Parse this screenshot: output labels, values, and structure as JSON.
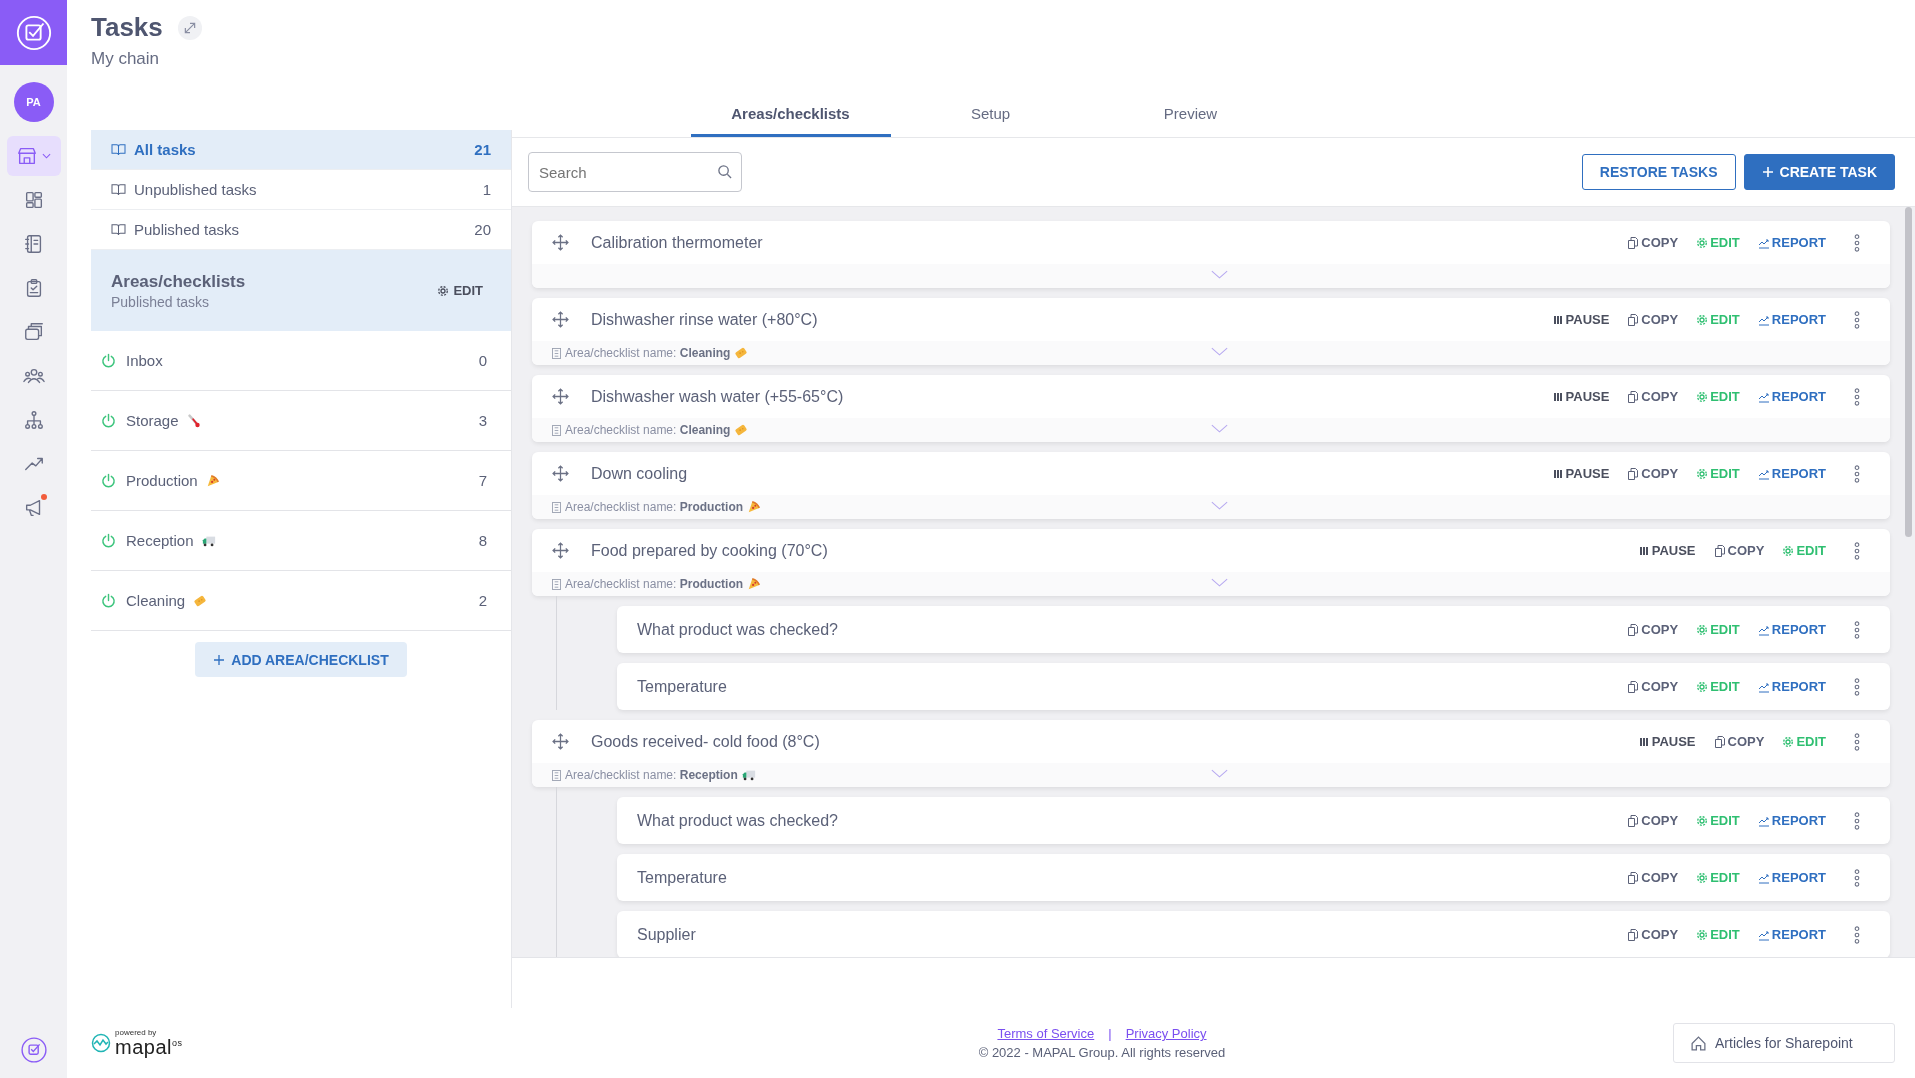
{
  "rail": {
    "avatar": "PA",
    "nav": [
      {
        "kind": "store",
        "selected": true,
        "notification": false
      },
      {
        "kind": "dashboard",
        "selected": false,
        "notification": false
      },
      {
        "kind": "notebook",
        "selected": false,
        "notification": false
      },
      {
        "kind": "clipboard",
        "selected": false,
        "notification": false
      },
      {
        "kind": "cards",
        "selected": false,
        "notification": false
      },
      {
        "kind": "people",
        "selected": false,
        "notification": false
      },
      {
        "kind": "hierarchy",
        "selected": false,
        "notification": false
      },
      {
        "kind": "trend",
        "selected": false,
        "notification": false
      },
      {
        "kind": "megaphone",
        "selected": false,
        "notification": true
      }
    ]
  },
  "header": {
    "title": "Tasks",
    "subtitle": "My chain"
  },
  "filters": [
    {
      "label": "All tasks",
      "count": "21",
      "selected": true
    },
    {
      "label": "Unpublished tasks",
      "count": "1",
      "selected": false
    },
    {
      "label": "Published tasks",
      "count": "20",
      "selected": false
    }
  ],
  "areas_header": {
    "title": "Areas/checklists",
    "subtitle": "Published tasks",
    "edit": "EDIT"
  },
  "areas": [
    {
      "label": "Inbox",
      "kind": "plain",
      "count": "0"
    },
    {
      "label": "Storage",
      "kind": "thermometer",
      "count": "3"
    },
    {
      "label": "Production",
      "kind": "pizza",
      "count": "7"
    },
    {
      "label": "Reception",
      "kind": "truck",
      "count": "8"
    },
    {
      "label": "Cleaning",
      "kind": "sponge",
      "count": "2"
    }
  ],
  "add_area": "ADD AREA/CHECKLIST",
  "tabs": [
    {
      "label": "Areas/checklists",
      "selected": true
    },
    {
      "label": "Setup",
      "selected": false
    },
    {
      "label": "Preview",
      "selected": false
    }
  ],
  "search": {
    "placeholder": "Search"
  },
  "buttons": [
    {
      "kind": "outline",
      "label": "RESTORE TASKS"
    },
    {
      "kind": "primary",
      "label": "CREATE TASK"
    }
  ],
  "tasks": [
    {
      "title": "Calibration thermometer",
      "actions": [
        {
          "kind": "copy",
          "label": "COPY"
        },
        {
          "kind": "edit",
          "label": "EDIT"
        },
        {
          "kind": "report",
          "label": "REPORT"
        }
      ]
    },
    {
      "title": "Dishwasher rinse water (+80°C)",
      "area": {
        "text": "Area/checklist name: **Cleaning**",
        "kind": "sponge"
      },
      "actions": [
        {
          "kind": "pause",
          "label": "PAUSE"
        },
        {
          "kind": "copy",
          "label": "COPY"
        },
        {
          "kind": "edit",
          "label": "EDIT"
        },
        {
          "kind": "report",
          "label": "REPORT"
        }
      ]
    },
    {
      "title": "Dishwasher wash water (+55-65°C)",
      "area": {
        "text": "Area/checklist name: **Cleaning**",
        "kind": "sponge"
      },
      "actions": [
        {
          "kind": "pause",
          "label": "PAUSE"
        },
        {
          "kind": "copy",
          "label": "COPY"
        },
        {
          "kind": "edit",
          "label": "EDIT"
        },
        {
          "kind": "report",
          "label": "REPORT"
        }
      ]
    },
    {
      "title": "Down cooling",
      "area": {
        "text": "Area/checklist name: **Production**",
        "kind": "pizza"
      },
      "actions": [
        {
          "kind": "pause",
          "label": "PAUSE"
        },
        {
          "kind": "copy",
          "label": "COPY"
        },
        {
          "kind": "edit",
          "label": "EDIT"
        },
        {
          "kind": "report",
          "label": "REPORT"
        }
      ]
    },
    {
      "title": "Food prepared by cooking (70°C)",
      "area": {
        "text": "Area/checklist name: **Production**",
        "kind": "pizza"
      },
      "actions": [
        {
          "kind": "pause",
          "label": "PAUSE"
        },
        {
          "kind": "copy",
          "label": "COPY"
        },
        {
          "kind": "edit",
          "label": "EDIT"
        }
      ],
      "children": [
        {
          "title": "What product was checked?",
          "actions": [
            {
              "kind": "copy",
              "label": "COPY"
            },
            {
              "kind": "edit",
              "label": "EDIT"
            },
            {
              "kind": "report",
              "label": "REPORT"
            }
          ]
        },
        {
          "title": "Temperature",
          "actions": [
            {
              "kind": "copy",
              "label": "COPY"
            },
            {
              "kind": "edit",
              "label": "EDIT"
            },
            {
              "kind": "report",
              "label": "REPORT"
            }
          ]
        }
      ]
    },
    {
      "title": "Goods received- cold food (8°C)",
      "area": {
        "text": "Area/checklist name: **Reception**",
        "kind": "truck"
      },
      "actions": [
        {
          "kind": "pause",
          "label": "PAUSE"
        },
        {
          "kind": "copy",
          "label": "COPY"
        },
        {
          "kind": "edit",
          "label": "EDIT"
        }
      ],
      "children": [
        {
          "title": "What product was checked?",
          "actions": [
            {
              "kind": "copy",
              "label": "COPY"
            },
            {
              "kind": "edit",
              "label": "EDIT"
            },
            {
              "kind": "report",
              "label": "REPORT"
            }
          ]
        },
        {
          "title": "Temperature",
          "actions": [
            {
              "kind": "copy",
              "label": "COPY"
            },
            {
              "kind": "edit",
              "label": "EDIT"
            },
            {
              "kind": "report",
              "label": "REPORT"
            }
          ]
        },
        {
          "title": "Supplier",
          "actions": [
            {
              "kind": "copy",
              "label": "COPY"
            },
            {
              "kind": "edit",
              "label": "EDIT"
            },
            {
              "kind": "report",
              "label": "REPORT"
            }
          ]
        }
      ]
    }
  ],
  "footer": {
    "powered_by": "powered by",
    "brand": "mapal",
    "brand_suffix": "os",
    "links": [
      "Terms of Service",
      "Privacy Policy"
    ],
    "separator": "|",
    "copyright": "© 2022 - MAPAL Group. All rights reserved",
    "help_button": "Articles for Sharepoint"
  }
}
